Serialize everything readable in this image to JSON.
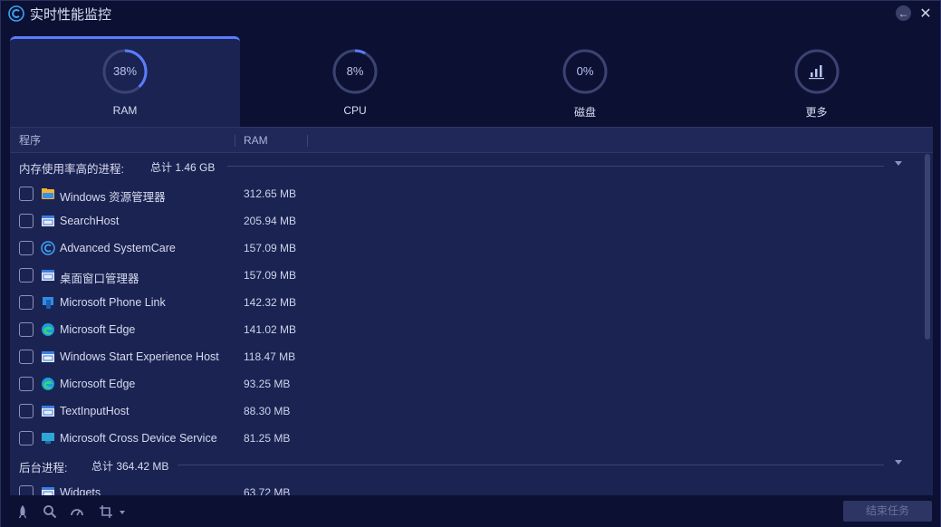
{
  "window": {
    "title": "实时性能监控"
  },
  "tabs": [
    {
      "label": "RAM",
      "value": "38%",
      "percent": 38,
      "active": true
    },
    {
      "label": "CPU",
      "value": "8%",
      "percent": 8,
      "active": false
    },
    {
      "label": "磁盘",
      "value": "0%",
      "percent": 0,
      "active": false
    },
    {
      "label": "更多",
      "icon": "bar-chart-icon",
      "active": false
    }
  ],
  "columns": {
    "program": "程序",
    "ram": "RAM"
  },
  "groups": {
    "high": {
      "title": "内存使用率高的进程:",
      "total": "总计 1.46 GB"
    },
    "background": {
      "title": "后台进程:",
      "total": "总计 364.42 MB"
    }
  },
  "processes": [
    {
      "name": "Windows 资源管理器",
      "ram": "312.65 MB",
      "icon": "folder-icon"
    },
    {
      "name": "SearchHost",
      "ram": "205.94 MB",
      "icon": "window-app-icon"
    },
    {
      "name": "Advanced SystemCare",
      "ram": "157.09 MB",
      "icon": "advanced-systemcare-icon"
    },
    {
      "name": "桌面窗口管理器",
      "ram": "157.09 MB",
      "icon": "window-app-icon"
    },
    {
      "name": "Microsoft Phone Link",
      "ram": "142.32 MB",
      "icon": "phone-link-icon"
    },
    {
      "name": "Microsoft Edge",
      "ram": "141.02 MB",
      "icon": "edge-icon"
    },
    {
      "name": "Windows Start Experience Host",
      "ram": "118.47 MB",
      "icon": "window-app-icon"
    },
    {
      "name": "Microsoft Edge",
      "ram": "93.25 MB",
      "icon": "edge-icon"
    },
    {
      "name": "TextInputHost",
      "ram": "88.30 MB",
      "icon": "window-app-icon"
    },
    {
      "name": "Microsoft Cross Device Service",
      "ram": "81.25 MB",
      "icon": "cross-device-icon"
    }
  ],
  "background_processes": [
    {
      "name": "Widgets",
      "ram": "63.72 MB",
      "icon": "window-app-icon"
    }
  ],
  "bottom": {
    "end_task_label": "结束任务"
  },
  "colors": {
    "accent": "#5b7cff",
    "background": "#0c1133",
    "panel": "#1b2352"
  }
}
